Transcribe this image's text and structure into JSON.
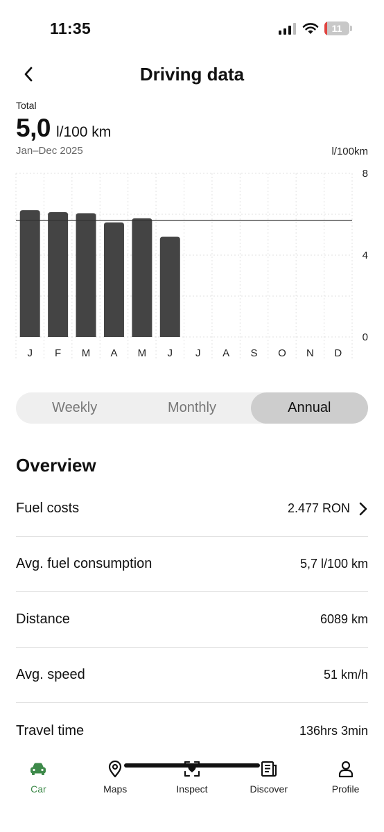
{
  "status_bar": {
    "time": "11:35",
    "battery": "11"
  },
  "header": {
    "title": "Driving data"
  },
  "summary": {
    "total_label": "Total",
    "total_value": "5,0",
    "total_unit": "l/100 km",
    "period": "Jan–Dec 2025",
    "axis_unit": "l/100km"
  },
  "chart_data": {
    "type": "bar",
    "categories": [
      "J",
      "F",
      "M",
      "A",
      "M",
      "J",
      "J",
      "A",
      "S",
      "O",
      "N",
      "D"
    ],
    "values": [
      6.2,
      6.1,
      6.05,
      5.6,
      5.8,
      4.9,
      null,
      null,
      null,
      null,
      null,
      null
    ],
    "average_line": 5.7,
    "ylim": [
      0,
      8
    ],
    "yticks": [
      "0",
      "4",
      "8"
    ],
    "grid": true,
    "bar_color": "#444444"
  },
  "tabs": {
    "weekly": "Weekly",
    "monthly": "Monthly",
    "annual": "Annual",
    "active": "annual"
  },
  "overview": {
    "title": "Overview",
    "rows": [
      {
        "label": "Fuel costs",
        "value": "2.477 RON"
      },
      {
        "label": "Avg. fuel consumption",
        "value": "5,7 l/100 km"
      },
      {
        "label": "Distance",
        "value": "6089 km"
      },
      {
        "label": "Avg. speed",
        "value": "51 km/h"
      },
      {
        "label": "Travel time",
        "value": "136hrs 3min"
      }
    ]
  },
  "nav": {
    "items": [
      {
        "label": "Car",
        "icon": "car-icon"
      },
      {
        "label": "Maps",
        "icon": "map-pin-icon"
      },
      {
        "label": "Inspect",
        "icon": "inspect-icon"
      },
      {
        "label": "Discover",
        "icon": "news-icon"
      },
      {
        "label": "Profile",
        "icon": "person-icon"
      }
    ],
    "active_color": "#3e8a4a"
  }
}
